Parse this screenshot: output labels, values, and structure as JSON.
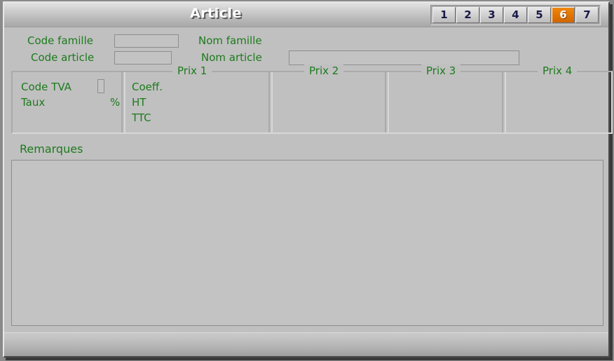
{
  "window": {
    "title": "Article"
  },
  "tabs": [
    {
      "label": "1",
      "active": false
    },
    {
      "label": "2",
      "active": false
    },
    {
      "label": "3",
      "active": false
    },
    {
      "label": "4",
      "active": false
    },
    {
      "label": "5",
      "active": false
    },
    {
      "label": "6",
      "active": true
    },
    {
      "label": "7",
      "active": false
    }
  ],
  "form": {
    "code_famille_label": "Code famille",
    "code_famille_value": "",
    "nom_famille_label": "Nom famille",
    "nom_famille_value": "",
    "code_article_label": "Code article",
    "code_article_value": "",
    "nom_article_label": "Nom article",
    "nom_article_value": ""
  },
  "prix": {
    "legends": [
      "Prix 1",
      "Prix 2",
      "Prix 3",
      "Prix 4"
    ],
    "tva": {
      "code_tva_label": "Code TVA",
      "code_tva_value": "",
      "taux_label": "Taux",
      "taux_value": "",
      "percent_symbol": "%"
    },
    "rows": {
      "coeff_label": "Coeff.",
      "ht_label": "HT",
      "ttc_label": "TTC"
    },
    "prix1": {
      "coeff_value": "",
      "ht_value": "",
      "ttc_value": ""
    },
    "prix2": {
      "coeff_value": "",
      "ht_value": "",
      "ttc_value": ""
    },
    "prix3": {
      "coeff_value": "",
      "ht_value": "",
      "ttc_value": ""
    },
    "prix4": {
      "coeff_value": "",
      "ht_value": "",
      "ttc_value": ""
    }
  },
  "remarques": {
    "label": "Remarques",
    "value": ""
  },
  "statusbar": {
    "text": ""
  },
  "colors": {
    "label_green": "#1d7a1d",
    "active_tab_orange": "#e07304",
    "window_face": "#c0c0c0",
    "field_face": "#c3c3c3",
    "title_text": "#ffffff"
  }
}
